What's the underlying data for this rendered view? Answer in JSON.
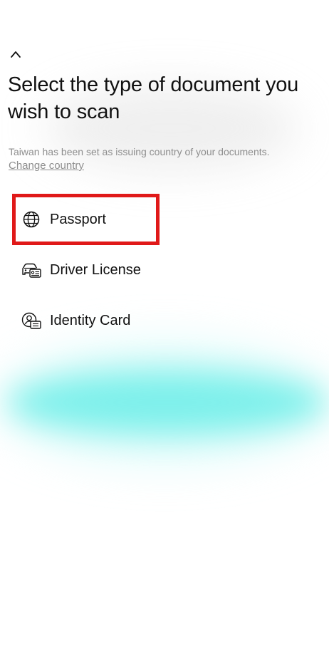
{
  "header": {
    "back_icon": "chevron-up-icon"
  },
  "page": {
    "title": "Select the type of document you wish to scan",
    "info_text": "Taiwan has been set as issuing country of your documents.",
    "change_country_label": "Change country"
  },
  "documents": [
    {
      "label": "Passport",
      "icon": "globe-icon",
      "highlighted": true
    },
    {
      "label": "Driver License",
      "icon": "car-id-card-icon",
      "highlighted": false
    },
    {
      "label": "Identity Card",
      "icon": "person-id-card-icon",
      "highlighted": false
    }
  ],
  "colors": {
    "highlight": "#e01919",
    "text_primary": "#111111",
    "text_secondary": "#8e8e8e",
    "accent_blur": "#5cece6"
  }
}
